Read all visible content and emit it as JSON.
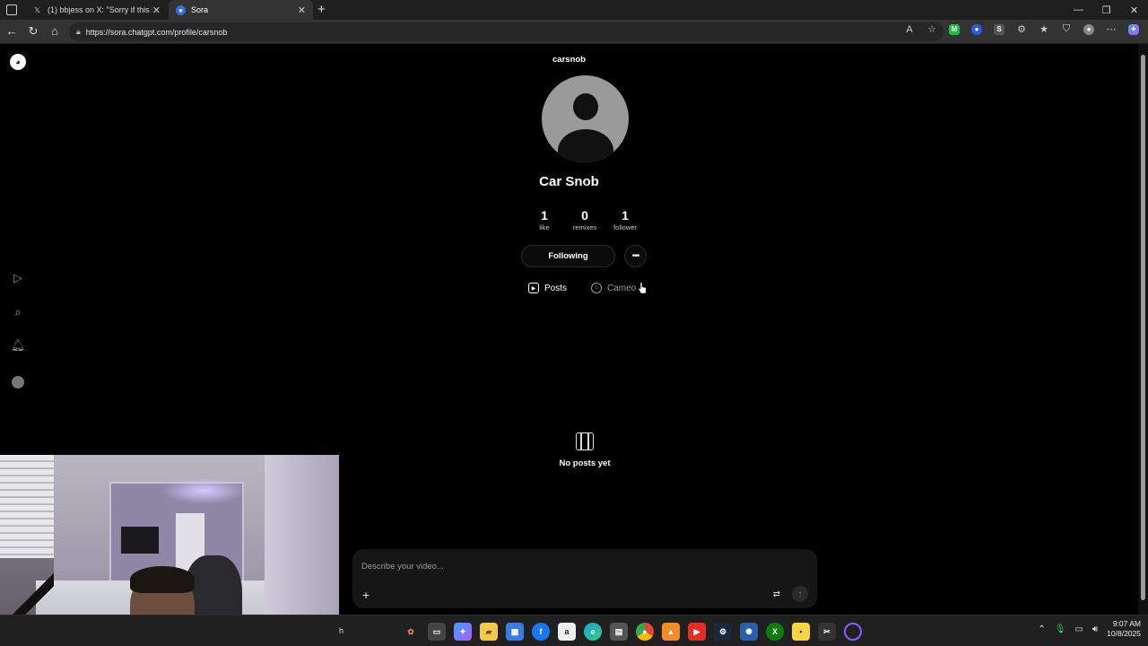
{
  "browser": {
    "tabs": [
      {
        "title": "(1) bbjess on X: \"Sorry if this is ou",
        "favicon": "x-icon",
        "active": false
      },
      {
        "title": "Sora",
        "favicon": "sora-icon",
        "active": true
      }
    ],
    "new_tab_glyph": "+",
    "url": "https://sora.chatgpt.com/profile/carsnob"
  },
  "profile": {
    "username": "carsnob",
    "display_name": "Car Snob",
    "stats": [
      {
        "value": "1",
        "label": "like"
      },
      {
        "value": "0",
        "label": "remixes"
      },
      {
        "value": "1",
        "label": "follower"
      }
    ],
    "following_label": "Following",
    "more_glyph": "•••",
    "tabs": [
      {
        "label": "Posts",
        "active": true
      },
      {
        "label": "Cameo",
        "active": false
      }
    ],
    "empty_state": "No posts yet"
  },
  "composer": {
    "placeholder": "Describe your video...",
    "plus_glyph": "+"
  },
  "taskbar": {
    "search_tail": "h",
    "time": "9:07 AM",
    "date": "10/8/2025"
  },
  "colors": {
    "page_bg": "#000000",
    "muted_text": "#9a9a9a",
    "avatar_bg": "#9a9a9a"
  }
}
